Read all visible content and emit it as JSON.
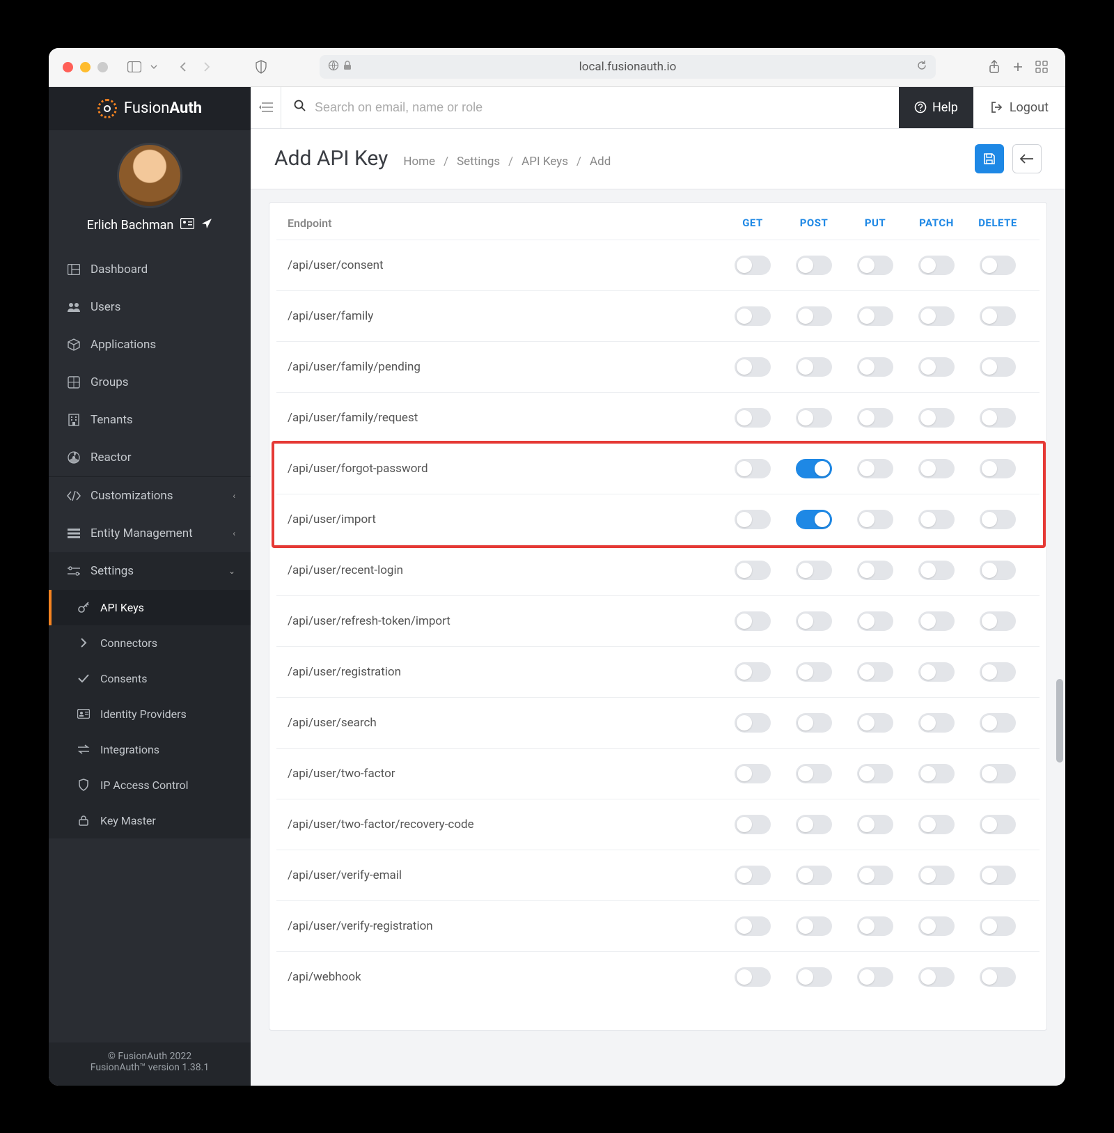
{
  "browser": {
    "url": "local.fusionauth.io"
  },
  "brand": {
    "name_light": "Fusion",
    "name_bold": "Auth"
  },
  "user": {
    "name": "Erlich Bachman"
  },
  "nav": {
    "items": [
      {
        "icon": "dashboard",
        "label": "Dashboard"
      },
      {
        "icon": "users",
        "label": "Users"
      },
      {
        "icon": "cube",
        "label": "Applications"
      },
      {
        "icon": "grid",
        "label": "Groups"
      },
      {
        "icon": "building",
        "label": "Tenants"
      },
      {
        "icon": "reactor",
        "label": "Reactor"
      }
    ],
    "groups": [
      {
        "icon": "code",
        "label": "Customizations"
      },
      {
        "icon": "entity",
        "label": "Entity Management"
      }
    ],
    "settings_label": "Settings",
    "settings_items": [
      {
        "icon": "key",
        "label": "API Keys",
        "active": true
      },
      {
        "icon": "chevron-right",
        "label": "Connectors"
      },
      {
        "icon": "check",
        "label": "Consents"
      },
      {
        "icon": "id",
        "label": "Identity Providers"
      },
      {
        "icon": "exchange",
        "label": "Integrations"
      },
      {
        "icon": "shield",
        "label": "IP Access Control"
      },
      {
        "icon": "lock",
        "label": "Key Master"
      }
    ]
  },
  "footer": {
    "copyright": "© FusionAuth 2022",
    "version": "FusionAuth™ version 1.38.1"
  },
  "topbar": {
    "search_placeholder": "Search on email, name or role",
    "help": "Help",
    "logout": "Logout"
  },
  "page": {
    "title": "Add API Key",
    "breadcrumbs": [
      "Home",
      "Settings",
      "API Keys",
      "Add"
    ]
  },
  "table": {
    "header_endpoint": "Endpoint",
    "methods": [
      "GET",
      "POST",
      "PUT",
      "PATCH",
      "DELETE"
    ],
    "rows": [
      {
        "endpoint": "/api/user/consent",
        "on": []
      },
      {
        "endpoint": "/api/user/family",
        "on": []
      },
      {
        "endpoint": "/api/user/family/pending",
        "on": []
      },
      {
        "endpoint": "/api/user/family/request",
        "on": []
      },
      {
        "endpoint": "/api/user/forgot-password",
        "on": [
          "POST"
        ],
        "highlight": true
      },
      {
        "endpoint": "/api/user/import",
        "on": [
          "POST"
        ],
        "highlight": true
      },
      {
        "endpoint": "/api/user/recent-login",
        "on": []
      },
      {
        "endpoint": "/api/user/refresh-token/import",
        "on": []
      },
      {
        "endpoint": "/api/user/registration",
        "on": []
      },
      {
        "endpoint": "/api/user/search",
        "on": []
      },
      {
        "endpoint": "/api/user/two-factor",
        "on": []
      },
      {
        "endpoint": "/api/user/two-factor/recovery-code",
        "on": []
      },
      {
        "endpoint": "/api/user/verify-email",
        "on": []
      },
      {
        "endpoint": "/api/user/verify-registration",
        "on": []
      },
      {
        "endpoint": "/api/webhook",
        "on": []
      }
    ]
  },
  "icons": {
    "dashboard": "▦",
    "users": "👥",
    "cube": "◧",
    "grid": "▤",
    "building": "🏢",
    "reactor": "☢",
    "code": "</>",
    "entity": "≡",
    "settings": "⚙",
    "key": "🔑",
    "chevron-right": "›",
    "check": "✔",
    "id": "🪪",
    "exchange": "⇄",
    "shield": "🛡",
    "lock": "🔒"
  }
}
